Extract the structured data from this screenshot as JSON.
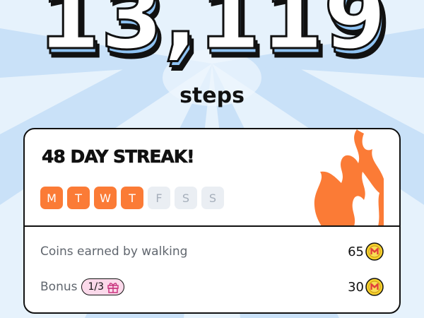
{
  "header": {
    "step_count": "13,119",
    "steps_label": "steps"
  },
  "streak": {
    "title": "48 DAY STREAK!",
    "days": [
      {
        "label": "M",
        "done": true
      },
      {
        "label": "T",
        "done": true
      },
      {
        "label": "W",
        "done": true
      },
      {
        "label": "T",
        "done": true
      },
      {
        "label": "F",
        "done": false
      },
      {
        "label": "S",
        "done": false
      },
      {
        "label": "S",
        "done": false
      }
    ],
    "flame_icon": "flame-icon"
  },
  "rewards": {
    "walking": {
      "label": "Coins earned by walking",
      "value": "65",
      "icon": "coin-icon"
    },
    "bonus": {
      "label": "Bonus",
      "badge": "1/3",
      "badge_icon": "gift-icon",
      "value": "30",
      "icon": "coin-icon"
    }
  },
  "colors": {
    "accent_orange": "#fb7b36",
    "inactive_day": "#eaeef3",
    "background": "#e3f0fc",
    "number_shadow": "#8fc3f3",
    "badge_pink": "#fbd9ea",
    "coin_yellow": "#f6cf2c",
    "coin_red": "#e2403a"
  }
}
